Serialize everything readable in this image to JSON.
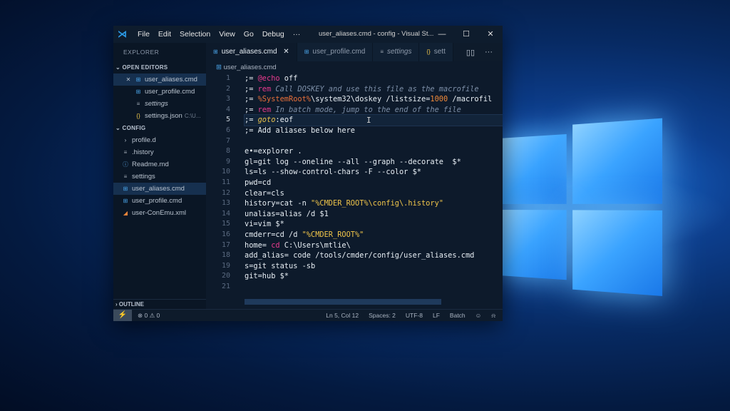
{
  "desktop": {
    "accent": "#1a78e8"
  },
  "window": {
    "title": "user_aliases.cmd - config - Visual St...",
    "menu": [
      "File",
      "Edit",
      "Selection",
      "View",
      "Go",
      "Debug",
      "···"
    ],
    "controls": {
      "minimize": "—",
      "maximize": "☐",
      "close": "✕"
    }
  },
  "sidebar": {
    "header": "EXPLORER",
    "open_editors": {
      "title": "OPEN EDITORS",
      "items": [
        {
          "label": "user_aliases.cmd",
          "icon": "windows-file-icon"
        },
        {
          "label": "user_profile.cmd",
          "icon": "windows-file-icon"
        },
        {
          "label": "settings",
          "icon": "settings-file-icon"
        },
        {
          "label": "settings.json",
          "path": "C:\\U...",
          "icon": "json-file-icon"
        }
      ]
    },
    "config": {
      "title": "CONFIG",
      "items": [
        {
          "label": "profile.d"
        },
        {
          "label": ".history"
        },
        {
          "label": "Readme.md"
        },
        {
          "label": "settings"
        },
        {
          "label": "user_aliases.cmd"
        },
        {
          "label": "user_profile.cmd"
        },
        {
          "label": "user-ConEmu.xml"
        }
      ]
    },
    "outline": "OUTLINE"
  },
  "tabs": [
    {
      "label": "user_aliases.cmd",
      "close": "✕"
    },
    {
      "label": "user_profile.cmd"
    },
    {
      "label": "settings"
    },
    {
      "label": "sett"
    }
  ],
  "tab_actions": {
    "split": "▯▯",
    "more": "···"
  },
  "breadcrumb": "user_aliases.cmd",
  "editor": {
    "line_numbers": [
      "1",
      "2",
      "3",
      "4",
      "5",
      "6",
      "7",
      "8",
      "9",
      "10",
      "11",
      "12",
      "13",
      "14",
      "15",
      "16",
      "17",
      "18",
      "19",
      "20",
      "21"
    ],
    "current_line": 5,
    "lines": {
      "l1_a": ";= ",
      "l1_b": "@echo",
      "l1_c": " off",
      "l2_a": ";= ",
      "l2_b": "rem",
      "l2_c": " Call DOSKEY and use this file as the macrofile",
      "l3_a": ";= ",
      "l3_b": "%SystemRoot%",
      "l3_c": "\\system32\\doskey /listsize=",
      "l3_d": "1000",
      "l3_e": " /macrofil",
      "l4_a": ";= ",
      "l4_b": "rem",
      "l4_c": " In batch mode, jump to the end of the file",
      "l5_a": ";= ",
      "l5_b": "goto",
      "l5_c": ":eof",
      "l6": ";= Add aliases below here",
      "l7": "",
      "l8": "e•=explorer .",
      "l9": "gl=git log --oneline --all --graph --decorate  $*",
      "l10": "ls=ls --show-control-chars -F --color $*",
      "l11": "pwd=cd",
      "l12": "clear=cls",
      "l13_a": "history=cat -n ",
      "l13_b": "\"%CMDER_ROOT%\\config\\.history\"",
      "l14": "unalias=alias /d $1",
      "l15": "vi=vim $*",
      "l16_a": "cmderr=cd /d ",
      "l16_b": "\"%CMDER_ROOT%\"",
      "l17_a": "home= ",
      "l17_b": "cd",
      "l17_c": " C:\\Users\\mtlie\\",
      "l18": "add_alias= code /tools/cmder/config/user_aliases.cmd",
      "l19": "s=git status -sb",
      "l20": "git=hub $*",
      "l21": ""
    }
  },
  "statusbar": {
    "problems": "⊗ 0 ⚠ 0",
    "position": "Ln 5, Col 12",
    "spaces": "Spaces: 2",
    "encoding": "UTF-8",
    "eol": "LF",
    "language": "Batch",
    "feedback": "☺",
    "bell": "🔔"
  }
}
